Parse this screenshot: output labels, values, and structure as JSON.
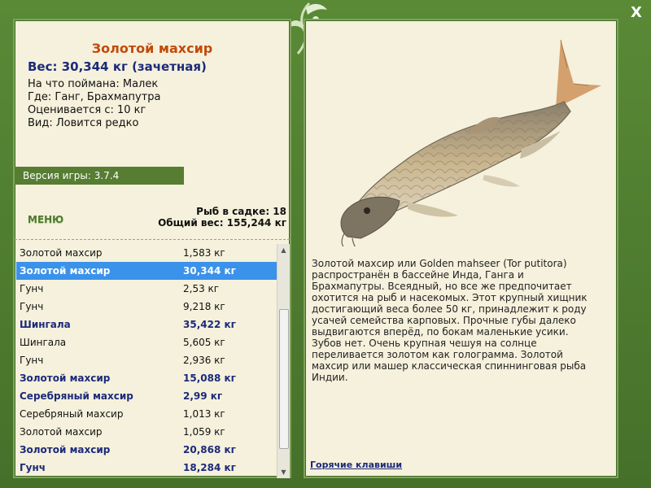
{
  "window": {
    "close_label": "X"
  },
  "fish": {
    "name": "Золотой махсир",
    "weight_line": "Вес: 30,344 кг (зачетная)",
    "info": [
      "На что поймана: Малек",
      "Где: Ганг, Брахмапутра",
      "Оценивается с: 10 кг",
      "Вид: Ловится редко"
    ],
    "description": "Золотой махсир или Golden mahseer (Tor putitora) распространён в бассейне Инда, Ганга и Брахмапутры. Всеядный, но все же предпочитает охотится на рыб и насекомых. Этот крупный хищник достигающий веса более 50 кг, принадлежит к роду усачей семейства карповых. Прочные губы далеко выдвигаются вперёд, по бокам маленькие усики. Зубов нет. Очень крупная чешуя на солнце переливается золотом как голограмма. Золотой махсир или машер классическая спиннинговая рыба Индии."
  },
  "version": "Версия игры: 3.7.4",
  "menu_label": "МЕНЮ",
  "keep": {
    "count_line": "Рыб в садке: 18",
    "total_line": "Общий вес: 155,244 кг"
  },
  "catch_list": [
    {
      "name": "Золотой махсир",
      "weight": "1,583 кг",
      "style": "normal"
    },
    {
      "name": "Золотой махсир",
      "weight": "30,344 кг",
      "style": "selected"
    },
    {
      "name": "Гунч",
      "weight": "2,53 кг",
      "style": "normal"
    },
    {
      "name": "Гунч",
      "weight": "9,218 кг",
      "style": "normal"
    },
    {
      "name": "Шингала",
      "weight": "35,422 кг",
      "style": "bold"
    },
    {
      "name": "Шингала",
      "weight": "5,605 кг",
      "style": "normal"
    },
    {
      "name": "Гунч",
      "weight": "2,936 кг",
      "style": "normal"
    },
    {
      "name": "Золотой махсир",
      "weight": "15,088 кг",
      "style": "bold"
    },
    {
      "name": "Серебряный махсир",
      "weight": "2,99 кг",
      "style": "bold"
    },
    {
      "name": "Серебряный махсир",
      "weight": "1,013 кг",
      "style": "normal"
    },
    {
      "name": "Золотой махсир",
      "weight": "1,059 кг",
      "style": "normal"
    },
    {
      "name": "Золотой махсир",
      "weight": "20,868 кг",
      "style": "bold"
    },
    {
      "name": "Гунч",
      "weight": "18,284 кг",
      "style": "bold"
    }
  ],
  "hotkeys_label": "Горячие клавиши",
  "colors": {
    "frame": "#4d7a2e",
    "panel": "#f5f1dc",
    "title": "#c24a0a",
    "bold_text": "#1c2a7a",
    "selection": "#3a92ea"
  }
}
